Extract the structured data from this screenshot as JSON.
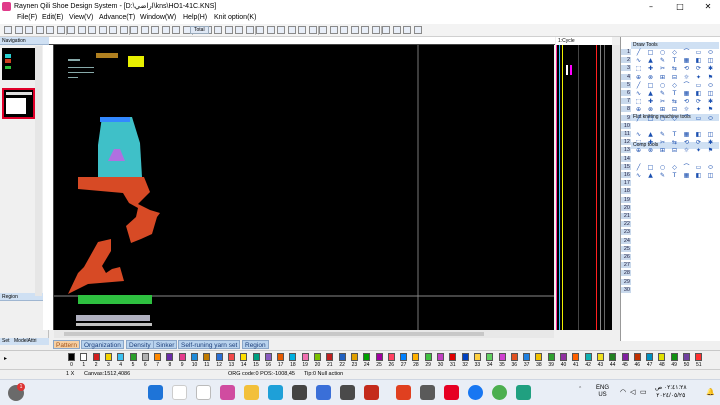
{
  "window": {
    "title": "Raynen Qili Shoe Design System - [D:\\اراضي\\kns\\HO1-41C.KNS]",
    "minimize": "–",
    "maximize": "□",
    "close": "✕"
  },
  "menu": [
    "File(F)",
    "Edit(E)",
    "View(V)",
    "Advance(T)",
    "Window(W)",
    "Help(H)",
    "Knit option(K)"
  ],
  "toolbar": {
    "zoom_label": "Total"
  },
  "navigator": {
    "header": "Navigation",
    "region_header": "Region"
  },
  "bottom_left": {
    "set_label": "Set",
    "model_label": "ModelAttri"
  },
  "cycle": {
    "header": "1:Cycle"
  },
  "tools": {
    "draw_header": "Draw Tools",
    "flat_header": "Flat knitting machine tools",
    "comp_header": "Comp tools",
    "row_numbers": [
      "1",
      "2",
      "3",
      "4",
      "5",
      "6",
      "7",
      "8",
      "9",
      "10",
      "11",
      "12",
      "13",
      "14",
      "15",
      "16",
      "17",
      "18",
      "19",
      "20",
      "21",
      "22",
      "23",
      "24",
      "25",
      "26",
      "27",
      "28",
      "29",
      "30"
    ]
  },
  "tabs": [
    "Pattern",
    "Organization",
    "Density",
    "Sinker",
    "Self-runing yarn set",
    "Region"
  ],
  "palette": {
    "numbers": [
      "0",
      "1",
      "2",
      "3",
      "4",
      "5",
      "6",
      "7",
      "8",
      "9",
      "10",
      "11",
      "12",
      "13",
      "14",
      "15",
      "16",
      "17",
      "18",
      "19",
      "20",
      "21",
      "22",
      "23",
      "24",
      "25",
      "26",
      "27",
      "28",
      "29",
      "30",
      "31",
      "32",
      "33",
      "34",
      "35",
      "36",
      "37",
      "38",
      "39",
      "40",
      "41",
      "42",
      "43",
      "44",
      "45",
      "46",
      "47",
      "48",
      "49",
      "50",
      "51"
    ],
    "colors": [
      "#000000",
      "#ffffff",
      "#d21f1f",
      "#f4d200",
      "#3cc1f0",
      "#2aa02a",
      "#b0b0b0",
      "#ff8800",
      "#6a2ca8",
      "#e43a8b",
      "#1e8ad8",
      "#c07a00",
      "#2a6fd4",
      "#f04848",
      "#ffe000",
      "#00a080",
      "#8a5cc0",
      "#e65a00",
      "#00b0e0",
      "#f070b0",
      "#7ac000",
      "#c02020",
      "#2060c0",
      "#e0a000",
      "#00a000",
      "#a000a0",
      "#ff4060",
      "#0080ff",
      "#ffb000",
      "#40c040",
      "#c040c0",
      "#e00000",
      "#0040c0",
      "#ffd040",
      "#60d060",
      "#d040d0",
      "#e05020",
      "#2080e0",
      "#f0c000",
      "#30a030",
      "#9030a0",
      "#ff6000",
      "#10b0b0",
      "#f0e020",
      "#208020",
      "#8020a0",
      "#c03000",
      "#0090c0",
      "#e0e000",
      "#109010",
      "#7040a0",
      "#ff3030"
    ]
  },
  "status": {
    "zoom": "1 X",
    "canvas": "Canvas:1512,4086",
    "org": "ORG code:0  POS:-1008,45",
    "tip": "Tip:0 Null action"
  },
  "taskbar": {
    "lang_top": "ENG",
    "lang_bottom": "US",
    "time": "٠٢:٤١:٢٨ ص",
    "date": "٢٠٢٤/٠٥/٢٥",
    "notif_count": "1"
  }
}
